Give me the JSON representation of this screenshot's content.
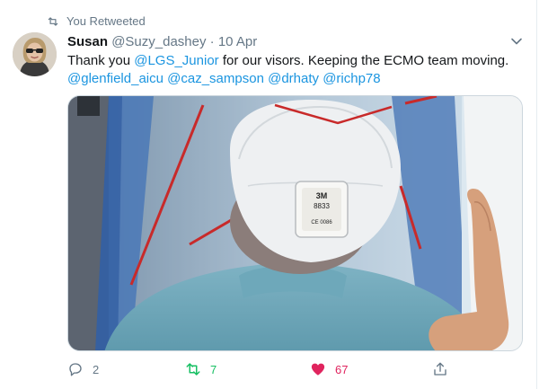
{
  "retweet_notice": {
    "label": "You Retweeted"
  },
  "author": {
    "name": "Susan",
    "handle": "@Suzy_dashey",
    "separator": "·",
    "date": "10 Apr"
  },
  "tweet": {
    "segments": [
      {
        "text": "Thank you ",
        "mention": false
      },
      {
        "text": "@LGS_Junior",
        "mention": true
      },
      {
        "text": " for our visors. Keeping the ECMO team moving.",
        "mention": false
      }
    ],
    "mentions_line": [
      "@glenfield_aicu",
      "@caz_sampson",
      "@drhaty",
      "@richp78"
    ]
  },
  "media": {
    "mask_brand": "3M",
    "mask_model": "8833",
    "mask_marking": "CE 0086"
  },
  "actions": {
    "replies": "2",
    "retweets": "7",
    "likes": "67"
  },
  "colors": {
    "accent": "#1b95e0",
    "retweet": "#17bf63",
    "like": "#e0245e",
    "muted": "#657786"
  }
}
